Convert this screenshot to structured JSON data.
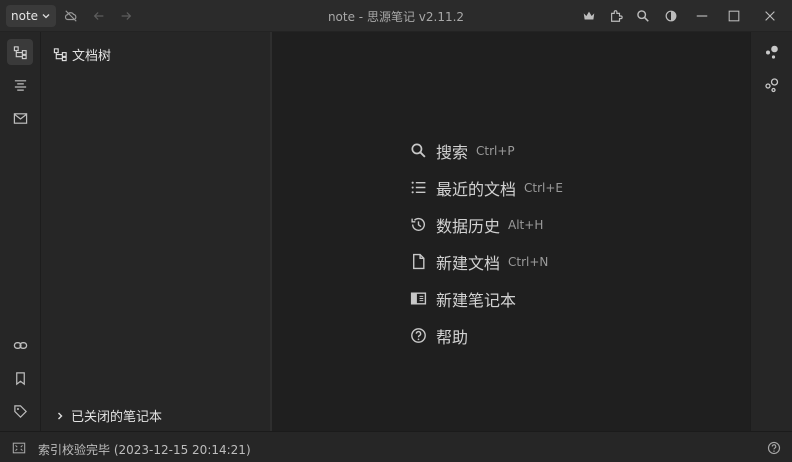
{
  "titlebar": {
    "workspace_label": "note",
    "title": "note - 思源笔记 v2.11.2",
    "icons": [
      "cloud-off-icon",
      "back-arrow-icon",
      "forward-arrow-icon",
      "crown-icon",
      "plugin-icon",
      "search-icon",
      "theme-icon",
      "minimize-icon",
      "maximize-icon",
      "close-icon"
    ]
  },
  "left_dock": {
    "top_icons": [
      "doc-tree-icon",
      "outline-icon",
      "inbox-icon"
    ],
    "bottom_icons": [
      "backlink-icon",
      "bookmark-icon",
      "tag-icon"
    ]
  },
  "tree_panel": {
    "title": "文档树",
    "closed_notebooks_label": "已关闭的笔记本"
  },
  "menu": {
    "items": [
      {
        "icon": "search-icon",
        "label": "搜索",
        "shortcut": "Ctrl+P"
      },
      {
        "icon": "list-icon",
        "label": "最近的文档",
        "shortcut": "Ctrl+E"
      },
      {
        "icon": "history-icon",
        "label": "数据历史",
        "shortcut": "Alt+H"
      },
      {
        "icon": "file-icon",
        "label": "新建文档",
        "shortcut": "Ctrl+N"
      },
      {
        "icon": "notebook-icon",
        "label": "新建笔记本",
        "shortcut": ""
      },
      {
        "icon": "help-icon",
        "label": "帮助",
        "shortcut": ""
      }
    ]
  },
  "right_dock": {
    "icons": [
      "graph-icon",
      "global-graph-icon"
    ]
  },
  "statusbar": {
    "text": "索引校验完毕 (2023-12-15 20:14:21)",
    "icons": [
      "dock-toggle-icon",
      "help-icon"
    ]
  },
  "colors": {
    "background": "#1e1e1e",
    "panel": "#262626",
    "titlebar": "#2b2b2b",
    "text": "#d2d2d2",
    "muted": "#9a9a9a"
  }
}
